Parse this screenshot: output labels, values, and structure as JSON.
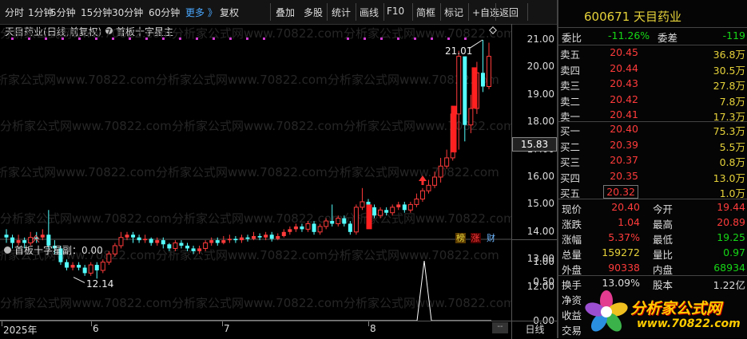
{
  "toolbar": {
    "items": [
      "分时",
      "1分钟",
      "5分钟",
      "15分钟",
      "30分钟",
      "60分钟",
      "更多 》",
      "复权",
      "叠加",
      "多股",
      "统计",
      "画线",
      "F10",
      "简框",
      "标记",
      "+自选",
      "返回"
    ]
  },
  "chart": {
    "title": "天目药业(日线,前复权)",
    "indicator": "首板十字星主",
    "sub_indicator": "首板十字星副：0.00",
    "price_ticks": [
      "21.00",
      "20.00",
      "19.00",
      "18.00",
      "17.00",
      "16.00",
      "15.00",
      "14.00",
      "13.00",
      "12.00"
    ],
    "current_price_label": "15.83",
    "high_label": "21.01",
    "low_label": "12.14",
    "sub_ticks": [
      "1.00",
      "0.50",
      "0.00"
    ],
    "time_labels": [
      "2025年",
      "6",
      "7",
      "8"
    ],
    "period_label": "日线",
    "badges": [
      "榜",
      "涨",
      "财"
    ],
    "watermark": "分析家公式网www.70822.com"
  },
  "quote": {
    "code_name": "600671 天目药业",
    "webi_label": "委比",
    "webi_value": "-11.26%",
    "weicha_label": "委差",
    "weicha_value": "-119",
    "asks": [
      {
        "label": "卖五",
        "price": "20.45",
        "vol": "36.8万"
      },
      {
        "label": "卖四",
        "price": "20.44",
        "vol": "30.5万"
      },
      {
        "label": "卖三",
        "price": "20.43",
        "vol": "27.8万"
      },
      {
        "label": "卖二",
        "price": "20.42",
        "vol": "7.8万"
      },
      {
        "label": "卖一",
        "price": "20.41",
        "vol": "17.3万"
      }
    ],
    "bids": [
      {
        "label": "买一",
        "price": "20.40",
        "vol": "75.3万"
      },
      {
        "label": "买二",
        "price": "20.39",
        "vol": "5.5万"
      },
      {
        "label": "买三",
        "price": "20.37",
        "vol": "0.8万"
      },
      {
        "label": "买四",
        "price": "20.35",
        "vol": "13.0万"
      },
      {
        "label": "买五",
        "price": "20.32",
        "vol": "1.0万"
      }
    ],
    "stats": [
      {
        "l1": "现价",
        "v1": "20.40",
        "l2": "今开",
        "v2": "19.44"
      },
      {
        "l1": "涨跌",
        "v1": "1.04",
        "l2": "最高",
        "v2": "20.89"
      },
      {
        "l1": "涨幅",
        "v1": "5.37%",
        "l2": "最低",
        "v2": "19.25"
      },
      {
        "l1": "总量",
        "v1": "159272",
        "l2": "量比",
        "v2": "0.97"
      },
      {
        "l1": "外盘",
        "v1": "90338",
        "l2": "内盘",
        "v2": "68934"
      }
    ],
    "extra": [
      {
        "l1": "换手",
        "v1": "13.09%",
        "l2": "股本",
        "v2": "1.22亿"
      },
      {
        "l1": "净资",
        "v1": ""
      },
      {
        "l1": "收益",
        "v1": ""
      },
      {
        "l1": "交易",
        "v1": ""
      }
    ],
    "logo_text": "分析家公式网",
    "logo_url": "www.70822.com"
  },
  "colors": {
    "up": "#ff3b3b",
    "down": "#54ffff",
    "flat": "#ffffff",
    "ma": "#ffffff"
  }
}
